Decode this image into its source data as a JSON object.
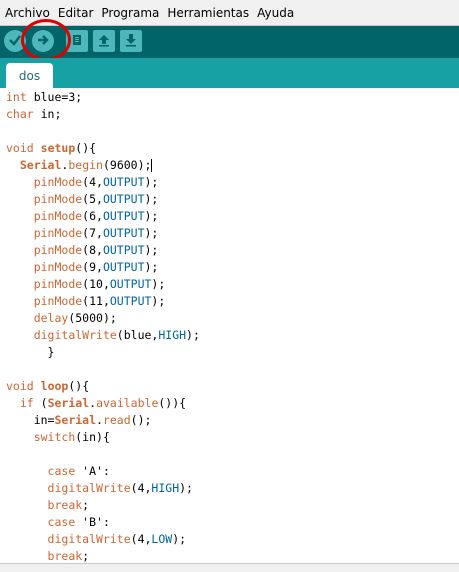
{
  "menu": [
    "Archivo",
    "Editar",
    "Programa",
    "Herramientas",
    "Ayuda"
  ],
  "toolbar": {
    "buttons": [
      {
        "name": "verify-button",
        "icon": "check-icon"
      },
      {
        "name": "upload-button",
        "icon": "arrow-right-icon"
      },
      {
        "name": "new-button",
        "icon": "document-icon"
      },
      {
        "name": "open-button",
        "icon": "arrow-up-icon"
      },
      {
        "name": "save-button",
        "icon": "arrow-down-icon"
      }
    ],
    "highlight_color": "#e00000"
  },
  "tab": {
    "label": "dos"
  },
  "code": [
    [
      {
        "t": "int",
        "c": "kw"
      },
      {
        "t": " blue=3;"
      }
    ],
    [
      {
        "t": "char",
        "c": "kw"
      },
      {
        "t": " in;"
      }
    ],
    [],
    [
      {
        "t": "void",
        "c": "kw"
      },
      {
        "t": " "
      },
      {
        "t": "setup",
        "c": "kwb"
      },
      {
        "t": "(){"
      }
    ],
    [
      {
        "t": "  "
      },
      {
        "t": "Serial",
        "c": "kwb"
      },
      {
        "t": "."
      },
      {
        "t": "begin",
        "c": "kw"
      },
      {
        "t": "(9600);"
      },
      {
        "cursor": true
      }
    ],
    [
      {
        "t": "    "
      },
      {
        "t": "pinMode",
        "c": "kw"
      },
      {
        "t": "(4,"
      },
      {
        "t": "OUTPUT",
        "c": "cst"
      },
      {
        "t": ");"
      }
    ],
    [
      {
        "t": "    "
      },
      {
        "t": "pinMode",
        "c": "kw"
      },
      {
        "t": "(5,"
      },
      {
        "t": "OUTPUT",
        "c": "cst"
      },
      {
        "t": ");"
      }
    ],
    [
      {
        "t": "    "
      },
      {
        "t": "pinMode",
        "c": "kw"
      },
      {
        "t": "(6,"
      },
      {
        "t": "OUTPUT",
        "c": "cst"
      },
      {
        "t": ");"
      }
    ],
    [
      {
        "t": "    "
      },
      {
        "t": "pinMode",
        "c": "kw"
      },
      {
        "t": "(7,"
      },
      {
        "t": "OUTPUT",
        "c": "cst"
      },
      {
        "t": ");"
      }
    ],
    [
      {
        "t": "    "
      },
      {
        "t": "pinMode",
        "c": "kw"
      },
      {
        "t": "(8,"
      },
      {
        "t": "OUTPUT",
        "c": "cst"
      },
      {
        "t": ");"
      }
    ],
    [
      {
        "t": "    "
      },
      {
        "t": "pinMode",
        "c": "kw"
      },
      {
        "t": "(9,"
      },
      {
        "t": "OUTPUT",
        "c": "cst"
      },
      {
        "t": ");"
      }
    ],
    [
      {
        "t": "    "
      },
      {
        "t": "pinMode",
        "c": "kw"
      },
      {
        "t": "(10,"
      },
      {
        "t": "OUTPUT",
        "c": "cst"
      },
      {
        "t": ");"
      }
    ],
    [
      {
        "t": "    "
      },
      {
        "t": "pinMode",
        "c": "kw"
      },
      {
        "t": "(11,"
      },
      {
        "t": "OUTPUT",
        "c": "cst"
      },
      {
        "t": ");"
      }
    ],
    [
      {
        "t": "    "
      },
      {
        "t": "delay",
        "c": "kw"
      },
      {
        "t": "(5000);"
      }
    ],
    [
      {
        "t": "    "
      },
      {
        "t": "digitalWrite",
        "c": "kw"
      },
      {
        "t": "(blue,"
      },
      {
        "t": "HIGH",
        "c": "cst"
      },
      {
        "t": ");"
      }
    ],
    [
      {
        "t": "      }"
      }
    ],
    [],
    [
      {
        "t": "void",
        "c": "kw"
      },
      {
        "t": " "
      },
      {
        "t": "loop",
        "c": "kwb"
      },
      {
        "t": "(){"
      }
    ],
    [
      {
        "t": "  "
      },
      {
        "t": "if",
        "c": "kw"
      },
      {
        "t": " ("
      },
      {
        "t": "Serial",
        "c": "kwb"
      },
      {
        "t": "."
      },
      {
        "t": "available",
        "c": "kw"
      },
      {
        "t": "()){"
      }
    ],
    [
      {
        "t": "    in="
      },
      {
        "t": "Serial",
        "c": "kwb"
      },
      {
        "t": "."
      },
      {
        "t": "read",
        "c": "kw"
      },
      {
        "t": "();"
      }
    ],
    [
      {
        "t": "    "
      },
      {
        "t": "switch",
        "c": "kw"
      },
      {
        "t": "(in){"
      }
    ],
    [],
    [
      {
        "t": "      "
      },
      {
        "t": "case",
        "c": "kw"
      },
      {
        "t": " 'A':"
      }
    ],
    [
      {
        "t": "      "
      },
      {
        "t": "digitalWrite",
        "c": "kw"
      },
      {
        "t": "(4,"
      },
      {
        "t": "HIGH",
        "c": "cst"
      },
      {
        "t": ");"
      }
    ],
    [
      {
        "t": "      "
      },
      {
        "t": "break",
        "c": "kw"
      },
      {
        "t": ";"
      }
    ],
    [
      {
        "t": "      "
      },
      {
        "t": "case",
        "c": "kw"
      },
      {
        "t": " 'B':"
      }
    ],
    [
      {
        "t": "      "
      },
      {
        "t": "digitalWrite",
        "c": "kw"
      },
      {
        "t": "(4,"
      },
      {
        "t": "LOW",
        "c": "cst"
      },
      {
        "t": ");"
      }
    ],
    [
      {
        "t": "      "
      },
      {
        "t": "break",
        "c": "kw"
      },
      {
        "t": ";"
      }
    ]
  ]
}
